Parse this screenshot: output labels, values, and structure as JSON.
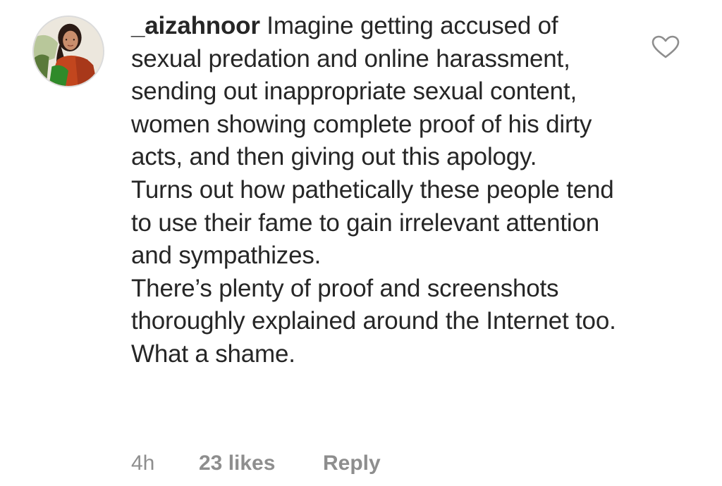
{
  "comment": {
    "username": "_aizahnoor",
    "text": "Imagine getting accused of sexual predation and online harassment, sending out inappropriate sexual content, women showing complete proof of his dirty acts, and then giving out this apology.\nTurns out how pathetically these people tend to use their fame to gain irrelevant attention and sympathizes.\nThere’s plenty of proof and screenshots thoroughly explained around the Internet too.\nWhat a shame.",
    "time": "4h",
    "likes": "23 likes",
    "reply_label": "Reply",
    "like_icon": "heart-outline-icon"
  },
  "colors": {
    "text": "#262626",
    "meta": "#8e8e8e",
    "icon": "#8e8e8e",
    "avatar_border": "#dbdbdb"
  }
}
